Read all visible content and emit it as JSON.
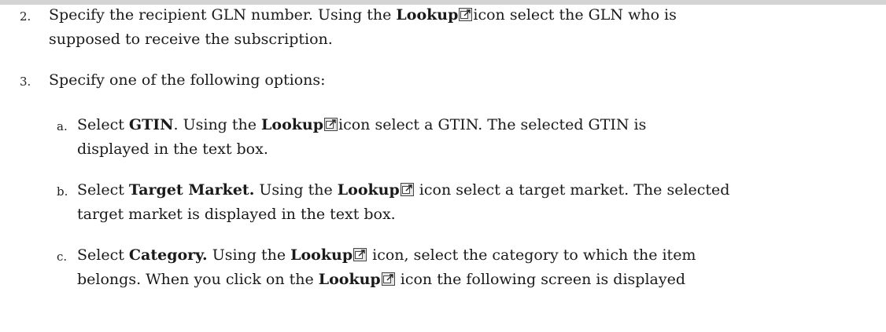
{
  "steps": [
    {
      "number": "2.",
      "line1": {
        "t1": "Specify the recipient GLN number. Using the ",
        "b1": "Lookup",
        "t2": "icon select the GLN who is"
      },
      "line2": "supposed to receive the subscription."
    },
    {
      "number": "3.",
      "line1": "Specify  one of the following options:"
    }
  ],
  "substeps": [
    {
      "letter": "a.",
      "line1": {
        "t1": "Select ",
        "b1": "GTIN",
        "t2": ". Using the ",
        "b2": "Lookup",
        "t3": "icon select a GTIN. The selected GTIN is"
      },
      "line2": "displayed in the text box."
    },
    {
      "letter": "b.",
      "line1": {
        "t1": "Select ",
        "b1": "Target Market.",
        "t2": " Using the ",
        "b2": "Lookup",
        "t3": " icon select a target market. The selected"
      },
      "line2": "target market is displayed in the text box."
    },
    {
      "letter": "c.",
      "line1": {
        "t1": "Select ",
        "b1": "Category.",
        "t2": " Using the ",
        "b2": "Lookup",
        "t3": " icon, select the category to which the item"
      },
      "line2": {
        "t1": "belongs. When you click on the ",
        "b1": "Lookup",
        "t2": " icon the following screen is displayed"
      }
    }
  ],
  "icons": {
    "lookup": "lookup-icon"
  }
}
